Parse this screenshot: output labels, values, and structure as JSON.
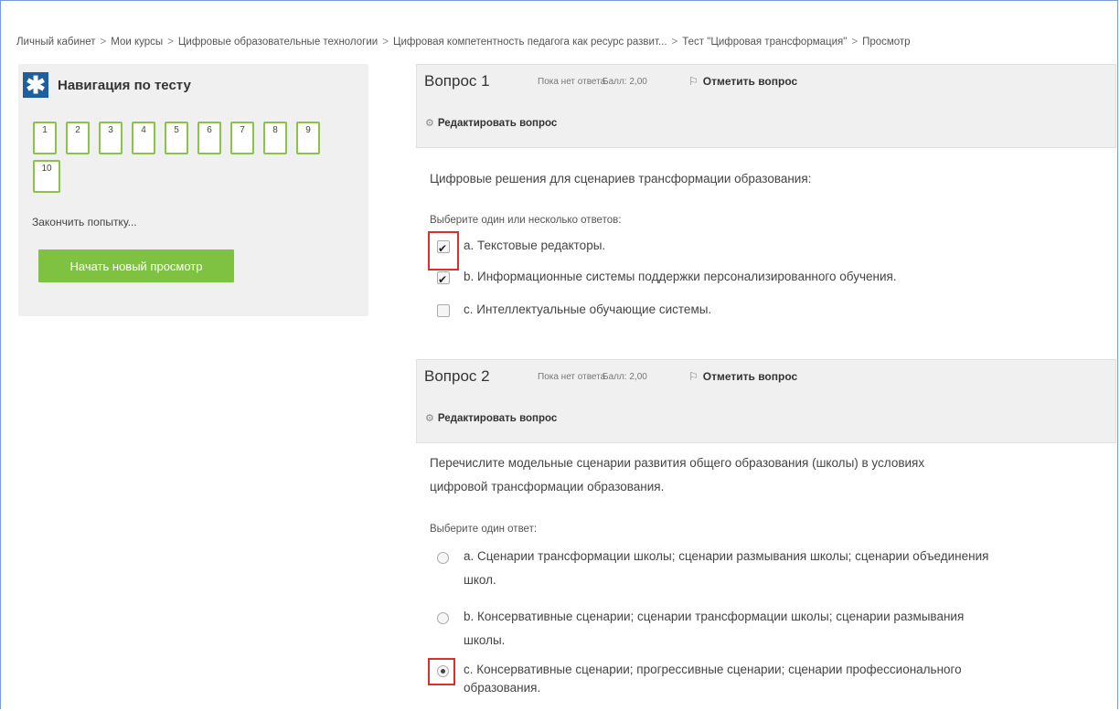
{
  "breadcrumb": [
    "Личный кабинет",
    "Мои курсы",
    "Цифровые образовательные технологии",
    "Цифровая компетентность педагога как ресурс развит...",
    "Тест \"Цифровая трансформация\"",
    "Просмотр"
  ],
  "breadcrumb_separator": ">",
  "nav": {
    "title": "Навигация по тесту",
    "icon": "asterisk-icon",
    "icon_glyph": "✱",
    "buttons": [
      "1",
      "2",
      "3",
      "4",
      "5",
      "6",
      "7",
      "8",
      "9",
      "10"
    ],
    "finish_link": "Закончить попытку...",
    "new_preview_button": "Начать новый просмотр"
  },
  "questions": [
    {
      "number_label": "Вопрос",
      "number": "1",
      "status": "Пока нет ответа",
      "mark": "Балл: 2,00",
      "flag_label": "Отметить вопрос",
      "edit_label": "Редактировать вопрос",
      "text": "Цифровые решения для сценариев трансформации образования:",
      "prompt": "Выберите один или несколько ответов:",
      "type": "checkbox",
      "answers": [
        {
          "text": "a. Текстовые редакторы.",
          "checked": true
        },
        {
          "text": "b. Информационные системы поддержки персонализированного обучения.",
          "checked": true
        },
        {
          "text": "c. Интеллектуальные обучающие системы.",
          "checked": false
        }
      ]
    },
    {
      "number_label": "Вопрос",
      "number": "2",
      "status": "Пока нет ответа",
      "mark": "Балл: 2,00",
      "flag_label": "Отметить вопрос",
      "edit_label": "Редактировать вопрос",
      "text_line1": "Перечислите модельные сценарии развития общего образования (школы) в условиях",
      "text_line2": "цифровой трансформации образования.",
      "prompt": "Выберите один ответ:",
      "type": "radio",
      "answers": [
        {
          "line1": "a. Сценарии трансформации школы; сценарии размывания школы; сценарии объединения",
          "line2": "школ.",
          "checked": false
        },
        {
          "line1": "b. Консервативные сценарии; сценарии трансформации школы; сценарии размывания",
          "line2": "школы.",
          "checked": false
        },
        {
          "line1": "c. Консервативные сценарии; прогрессивные сценарии; сценарии профессионального",
          "line2": "образования.",
          "checked": true
        }
      ]
    }
  ],
  "colors": {
    "accent_green": "#7fc241",
    "nav_icon_blue": "#1f5f9e",
    "highlight_red": "#d9302c",
    "panel_gray": "#f0f0f0"
  }
}
